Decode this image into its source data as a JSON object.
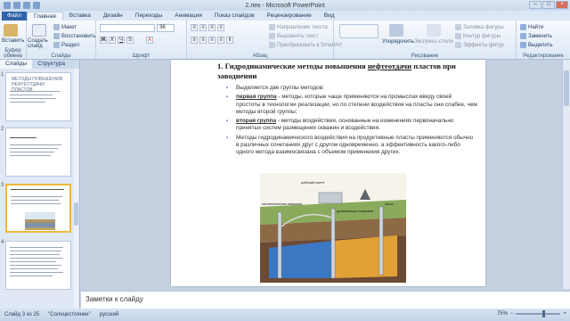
{
  "window": {
    "title": "2.лек - Microsoft PowerPoint",
    "controls": [
      "–",
      "□",
      "×"
    ]
  },
  "tabs": [
    "Файл",
    "Главная",
    "Вставка",
    "Дизайн",
    "Переходы",
    "Анимация",
    "Показ слайдов",
    "Рецензирование",
    "Вид"
  ],
  "ribbon": {
    "clipboard": {
      "paste_label": "Вставить",
      "group_label": "Буфер обмена"
    },
    "slides": {
      "create_label": "Создать слайд",
      "layout_label": "Макет",
      "reset_label": "Восстановить",
      "section_label": "Раздел",
      "group_label": "Слайды"
    },
    "font": {
      "font_size": "36",
      "group_label": "Шрифт"
    },
    "paragraph": {
      "text_direction_label": "Направление текста",
      "align_text_label": "Выровнять текст",
      "convert_label": "Преобразовать в SmartArt",
      "group_label": "Абзац"
    },
    "drawing": {
      "arrange_label": "Упорядочить",
      "quick_styles_label": "Экспресс-стили",
      "fill_label": "Заливка фигуры",
      "outline_label": "Контур фигуры",
      "effects_label": "Эффекты фигур",
      "group_label": "Рисование"
    },
    "editing": {
      "find_label": "Найти",
      "replace_label": "Заменить",
      "select_label": "Выделить",
      "group_label": "Редактирование"
    }
  },
  "pane": {
    "tabs": [
      "Слайды",
      "Структура"
    ],
    "slide_numbers": [
      "1",
      "2",
      "3",
      "4"
    ],
    "slide1_title": "МЕТОДЫ ПОВЫШЕНИЯ НЕФТЕОТДАЧИ ПЛАСТОВ"
  },
  "slide": {
    "title_prefix": "1. Гидродинамические методы повышения ",
    "title_underlined": "нефтеотдачи",
    "title_suffix": " пластов при заводнении",
    "intro": "Выделяется две группы методов:",
    "group1_label": "первая группа",
    "group1_text": " - методы, которые чаще применяются на промыслах ввиду своей простоты в технологии реализации, но по степени воздействия на пласты они слабее, чем методы второй группы;",
    "group2_label": "вторая группа",
    "group2_text": " - методы воздействия, основанные на изменениях первоначально принятых систем размещения скважин и воздействия.",
    "paragraph3": "Методы гидродинамического воздействия на продуктивные пласты применяются обычно в различных сочетаниях друг с другом одновременно, а эффективность какого-либо одного метода взаимосвязана с объемом применения других.",
    "illustration_labels": {
      "work_agent": "рабочий агент",
      "injection_well": "нагнетательная скважина",
      "production_well": "добывающая скважина",
      "pump": "насос"
    }
  },
  "notes": {
    "placeholder": "Заметки к слайду"
  },
  "status": {
    "slide_counter": "Слайд 3 из 25",
    "theme": "\"Солнцестояние\"",
    "language": "русский",
    "zoom": "75%"
  },
  "colors": {
    "file_tab": "#2f62a8",
    "accent_bullet": "#3f74c2",
    "selection": "#f0b93c"
  }
}
